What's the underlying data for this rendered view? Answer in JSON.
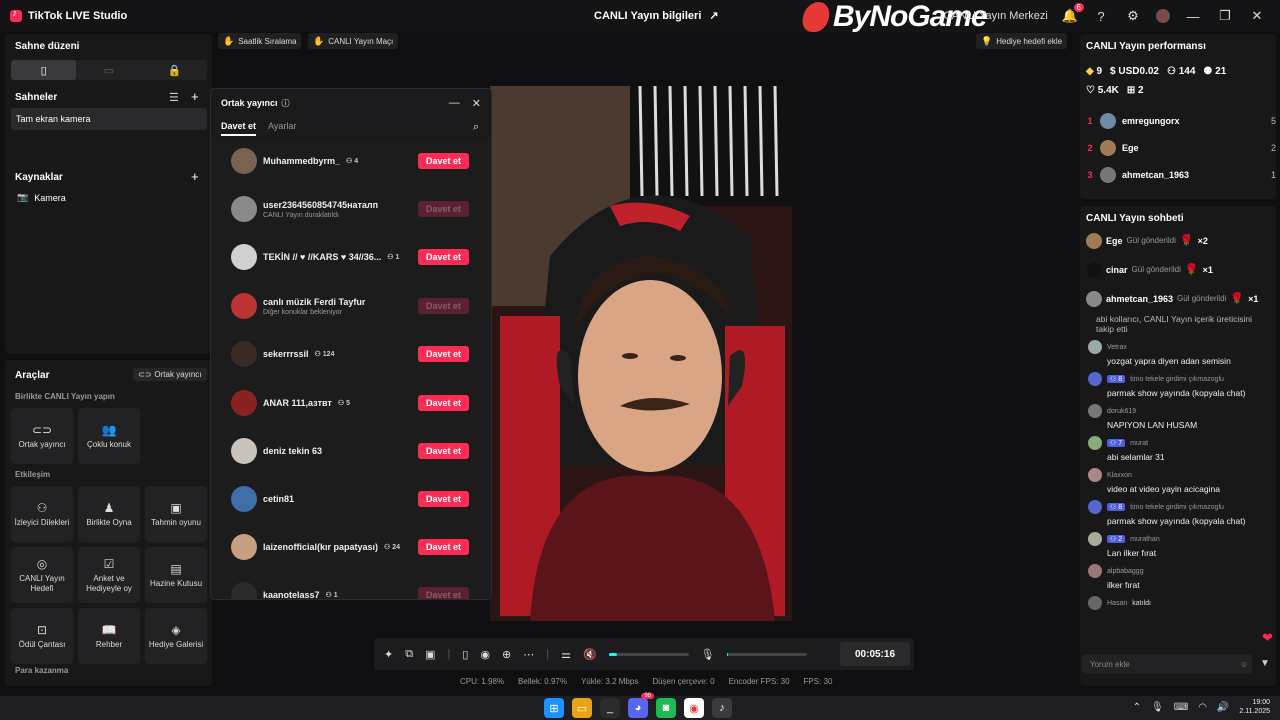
{
  "titlebar": {
    "app_name": "TikTok LIVE Studio",
    "center_title": "CANLI Yayın bilgileri",
    "watermark": "ByNoGame",
    "live_center": "CANLI Yayın Merkezi",
    "notification_count": "6"
  },
  "left": {
    "scene_layout_title": "Sahne düzeni",
    "scenes_title": "Sahneler",
    "scene_item": "Tam ekran kamera",
    "sources_title": "Kaynaklar",
    "source_item": "Kamera",
    "tools_title": "Araçlar",
    "cohost_button": "Ortak yayıncı",
    "together_title": "Birlikte CANLI Yayın yapın",
    "together_tools": [
      {
        "label": "Ortak yayıncı",
        "icon": "link-icon"
      },
      {
        "label": "Çoklu konuk",
        "icon": "users-icon"
      }
    ],
    "engagement_title": "Etkileşim",
    "engagement_tools": [
      {
        "label": "İzleyici Dilekleri",
        "icon": "people-icon"
      },
      {
        "label": "Birlikte Oyna",
        "icon": "gamepad-icon"
      },
      {
        "label": "Tahmin oyunu",
        "icon": "prediction-icon"
      },
      {
        "label": "CANLI Yayın Hedefi",
        "icon": "target-icon"
      },
      {
        "label": "Anket ve Hediyeyle oy",
        "icon": "poll-icon"
      },
      {
        "label": "Hazine Kutusu",
        "icon": "treasure-icon"
      },
      {
        "label": "Ödül Çantası",
        "icon": "bag-icon"
      },
      {
        "label": "Rehber",
        "icon": "book-icon"
      },
      {
        "label": "Hediye Galerisi",
        "icon": "gift-icon"
      }
    ],
    "monetize_title": "Para kazanma"
  },
  "top_pills": {
    "hourly_ranking": "Saatlik Sıralama",
    "live_match": "CANLI Yayın Maçı",
    "gift_goal": "Hediye hedefi ekle"
  },
  "dialog": {
    "title": "Ortak yayıncı",
    "tab_invite": "Davet et",
    "tab_settings": "Ayarlar",
    "rows": [
      {
        "name": "Muhammedbyrm_",
        "count": "4",
        "sub": "",
        "button": "Davet et",
        "disabled": false,
        "color": "#7a6150"
      },
      {
        "name": "user2364560854745наталп",
        "count": "",
        "sub": "CANLI Yayın duraklatıldı",
        "button": "Davet et",
        "disabled": true,
        "color": "#8a8a8a"
      },
      {
        "name": "TEKİN // ♥ //KARS ♥ 34//36...",
        "count": "1",
        "sub": "",
        "button": "Davet et",
        "disabled": false,
        "color": "#d0d0d0"
      },
      {
        "name": "canlı müzik Ferdi Tayfur",
        "count": "",
        "sub": "Diğer konuklar bekleniyor",
        "button": "Davet et",
        "disabled": true,
        "color": "#b33"
      },
      {
        "name": "sekerrrssil",
        "count": "124",
        "sub": "",
        "button": "Davet et",
        "disabled": false,
        "color": "#3a2a24"
      },
      {
        "name": "ANAR 111,азтвт",
        "count": "5",
        "sub": "",
        "button": "Davet et",
        "disabled": false,
        "color": "#8a2222"
      },
      {
        "name": "deniz tekin 63",
        "count": "",
        "sub": "",
        "button": "Davet et",
        "disabled": false,
        "color": "#c9c3bd"
      },
      {
        "name": "cetin81",
        "count": "",
        "sub": "",
        "button": "Davet et",
        "disabled": false,
        "color": "#3f6fa8"
      },
      {
        "name": "laizenofficial(kır papatyası)",
        "count": "24",
        "sub": "",
        "button": "Davet et",
        "disabled": false,
        "color": "#c8a080"
      },
      {
        "name": "kaanotelass7",
        "count": "1",
        "sub": "",
        "button": "Davet et",
        "disabled": true,
        "color": "#2a2a2a"
      }
    ]
  },
  "controls": {
    "timer": "00:05:16",
    "volume_level": 0.1,
    "mic_level": 0.02
  },
  "stats": {
    "cpu": "CPU: 1.98%",
    "memory": "Bellek: 0.97%",
    "upload": "Yükle: 3.2 Mbps",
    "dropped": "Düşen çerçeve: 0",
    "encoder_fps": "Encoder FPS: 30",
    "fps": "FPS: 30"
  },
  "right": {
    "perf_title": "CANLI Yayın performansı",
    "perf": {
      "diamonds": "9",
      "usd": "USD0.02",
      "viewers": "144",
      "live_viewers": "21",
      "likes": "5.4K",
      "gifters": "2"
    },
    "ranking": [
      {
        "rank": "1",
        "name": "emregungorx",
        "value": "5"
      },
      {
        "rank": "2",
        "name": "Ege",
        "value": "2"
      },
      {
        "rank": "3",
        "name": "ahmetcan_1963",
        "value": "1"
      }
    ],
    "chat_title": "CANLI Yayın sohbeti",
    "gifts": [
      {
        "name": "Ege",
        "text": "Gül gönderildi",
        "mult": "×2"
      },
      {
        "name": "cinar",
        "text": "Gül gönderildi",
        "mult": "×1"
      },
      {
        "name": "ahmetcan_1963",
        "text": "Gül gönderildi",
        "mult": "×1"
      }
    ],
    "partial_message": "abi kollarıcı, CANLI Yayın içerik üreticisini takip etti",
    "messages": [
      {
        "user": "Vetrax",
        "level": "",
        "text": "yozgat yapra diyen adan semisin"
      },
      {
        "user": "timo tekele girdimi çıkmazoglu",
        "level": "8",
        "text": "parmak show yayında (kopyala chat)"
      },
      {
        "user": "doruk619",
        "level": "",
        "text": "NAPIYON LAN HUSAM"
      },
      {
        "user": "murat",
        "level": "7",
        "text": "abi selamlar 31"
      },
      {
        "user": "Klaxxon",
        "level": "",
        "text": "video at video yayin acicagina"
      },
      {
        "user": "timo tekele girdimi çıkmazoglu",
        "level": "8",
        "text": "parmak show yayında (kopyala chat)"
      },
      {
        "user": "murathan",
        "level": "2",
        "text": "Lan ilker fırat"
      },
      {
        "user": "alpbabaggg",
        "level": "",
        "text": "ilker fırat"
      }
    ],
    "joined": {
      "user": "Hasan",
      "text": "katıldı"
    },
    "comment_placeholder": "Yorum ekle"
  },
  "taskbar": {
    "time": "19:00",
    "date": "2.11.2025",
    "discord_badge": "99"
  }
}
